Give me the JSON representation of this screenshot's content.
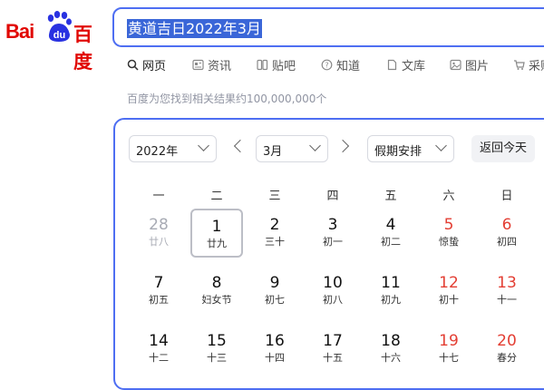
{
  "logo": {
    "bai": "Bai",
    "du": "du",
    "cn": "百度"
  },
  "search": {
    "query": "黄道吉日2022年3月"
  },
  "tabs": [
    {
      "label": "网页",
      "icon": "search-icon",
      "active": true
    },
    {
      "label": "资讯",
      "icon": "news-icon",
      "active": false
    },
    {
      "label": "贴吧",
      "icon": "tieba-icon",
      "active": false
    },
    {
      "label": "知道",
      "icon": "question-icon",
      "active": false
    },
    {
      "label": "文库",
      "icon": "document-icon",
      "active": false
    },
    {
      "label": "图片",
      "icon": "image-icon",
      "active": false
    },
    {
      "label": "采购",
      "icon": "cart-icon",
      "active": false
    }
  ],
  "result_count": "百度为您找到相关结果约100,000,000个",
  "calendar": {
    "year_select": "2022年",
    "month_select": "3月",
    "holiday_select": "假期安排",
    "today_button": "返回今天",
    "weekdays": [
      "一",
      "二",
      "三",
      "四",
      "五",
      "六",
      "日"
    ],
    "weeks": [
      [
        {
          "n": "28",
          "l": "廿八",
          "other": true
        },
        {
          "n": "1",
          "l": "廿九",
          "selected": true
        },
        {
          "n": "2",
          "l": "三十"
        },
        {
          "n": "3",
          "l": "初一"
        },
        {
          "n": "4",
          "l": "初二"
        },
        {
          "n": "5",
          "l": "惊蛰",
          "weekend": true
        },
        {
          "n": "6",
          "l": "初四",
          "weekend": true
        }
      ],
      [
        {
          "n": "7",
          "l": "初五"
        },
        {
          "n": "8",
          "l": "妇女节"
        },
        {
          "n": "9",
          "l": "初七"
        },
        {
          "n": "10",
          "l": "初八"
        },
        {
          "n": "11",
          "l": "初九"
        },
        {
          "n": "12",
          "l": "初十",
          "weekend": true
        },
        {
          "n": "13",
          "l": "十一",
          "weekend": true
        }
      ],
      [
        {
          "n": "14",
          "l": "十二"
        },
        {
          "n": "15",
          "l": "十三"
        },
        {
          "n": "16",
          "l": "十四"
        },
        {
          "n": "17",
          "l": "十五"
        },
        {
          "n": "18",
          "l": "十六"
        },
        {
          "n": "19",
          "l": "十七",
          "weekend": true
        },
        {
          "n": "20",
          "l": "春分",
          "weekend": true
        }
      ]
    ]
  },
  "colors": {
    "accent": "#4e6ef2",
    "brand_red": "#e10601",
    "weekend_red": "#e33e33"
  }
}
